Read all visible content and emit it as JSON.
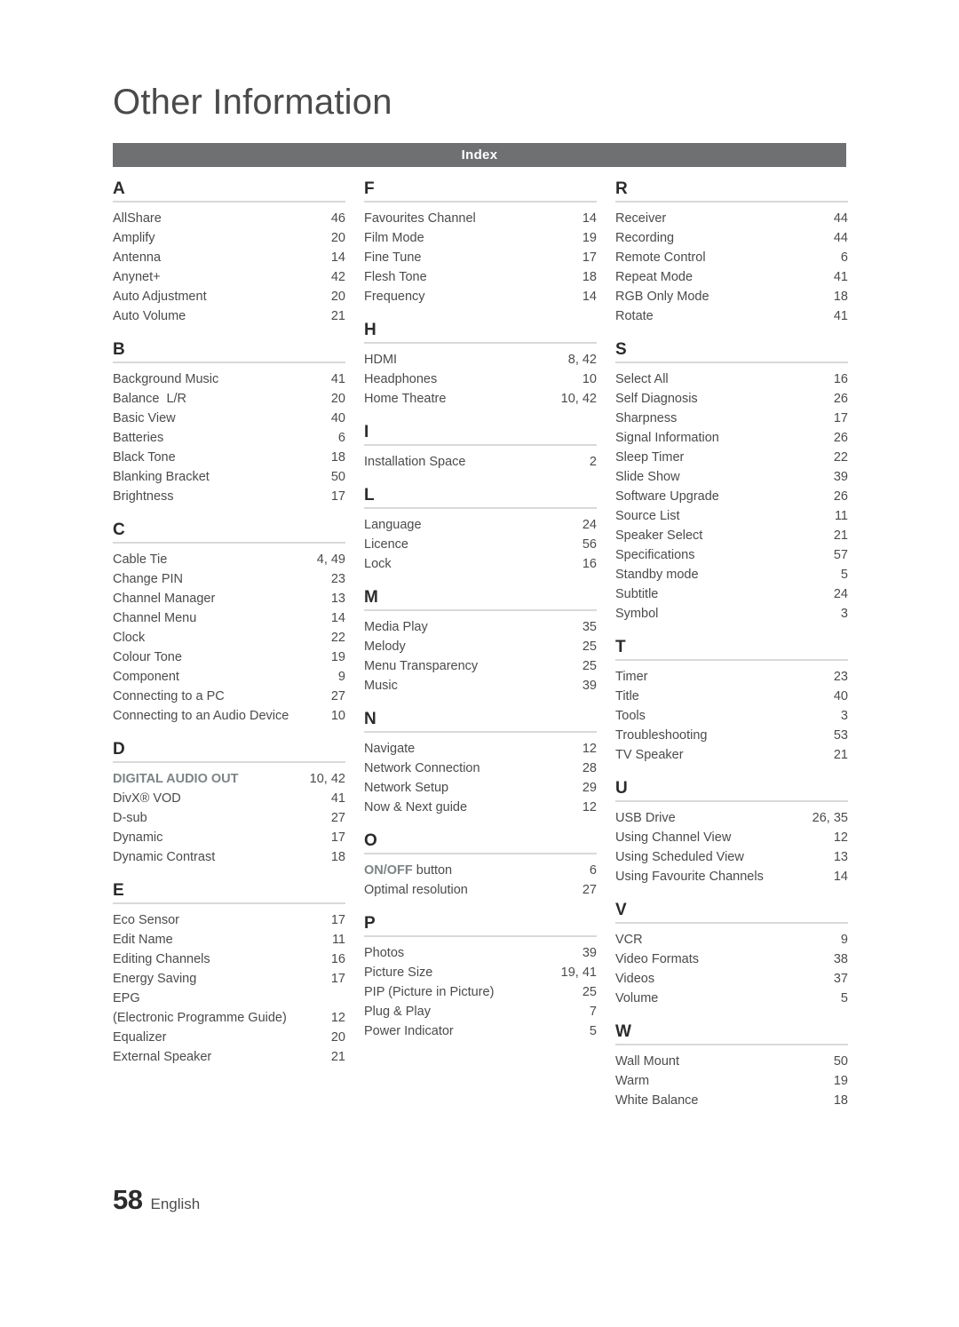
{
  "chapter": {
    "title": "Other Information"
  },
  "index_bar": {
    "label": "Index"
  },
  "footer": {
    "page_number": "58",
    "language": "English"
  },
  "colors": {
    "index_bar_bg": "#6e7072",
    "index_bar_text": "#ffffff",
    "rule": "#d9d9d9",
    "body_text": "#4b4b4b",
    "letter_text": "#2b2b2b",
    "emphasis_text": "#7d8486"
  },
  "columns": [
    {
      "sections": [
        {
          "letter": "A",
          "entries": [
            {
              "label": "AllShare",
              "page": "46"
            },
            {
              "label": "Amplify",
              "page": "20"
            },
            {
              "label": "Antenna",
              "page": "14"
            },
            {
              "label": "Anynet+",
              "page": "42"
            },
            {
              "label": "Auto Adjustment",
              "page": "20"
            },
            {
              "label": "Auto Volume",
              "page": "21"
            }
          ]
        },
        {
          "letter": "B",
          "entries": [
            {
              "label": "Background Music",
              "page": "41"
            },
            {
              "label": "Balance  L/R",
              "page": "20"
            },
            {
              "label": "Basic View",
              "page": "40"
            },
            {
              "label": "Batteries",
              "page": "6"
            },
            {
              "label": "Black Tone",
              "page": "18"
            },
            {
              "label": "Blanking Bracket",
              "page": "50"
            },
            {
              "label": "Brightness",
              "page": "17"
            }
          ]
        },
        {
          "letter": "C",
          "entries": [
            {
              "label": "Cable Tie",
              "page": "4, 49"
            },
            {
              "label": "Change PIN",
              "page": "23"
            },
            {
              "label": "Channel Manager",
              "page": "13"
            },
            {
              "label": "Channel Menu",
              "page": "14"
            },
            {
              "label": "Clock",
              "page": "22"
            },
            {
              "label": "Colour Tone",
              "page": "19"
            },
            {
              "label": "Component",
              "page": "9"
            },
            {
              "label": "Connecting to a PC",
              "page": "27"
            },
            {
              "label": "Connecting to an Audio Device",
              "page": "10"
            }
          ]
        },
        {
          "letter": "D",
          "entries": [
            {
              "label": "DIGITAL AUDIO OUT",
              "page": "10, 42",
              "style": "emph"
            },
            {
              "label": "DivX® VOD",
              "page": "41"
            },
            {
              "label": "D-sub",
              "page": "27"
            },
            {
              "label": "Dynamic",
              "page": "17"
            },
            {
              "label": "Dynamic Contrast",
              "page": "18"
            }
          ]
        },
        {
          "letter": "E",
          "entries": [
            {
              "label": "Eco Sensor",
              "page": "17"
            },
            {
              "label": "Edit Name",
              "page": "11"
            },
            {
              "label": "Editing Channels",
              "page": "16"
            },
            {
              "label": "Energy Saving",
              "page": "17"
            },
            {
              "label": "EPG",
              "label2": "(Electronic Programme Guide)",
              "page": "12",
              "style": "multiline"
            },
            {
              "label": "Equalizer",
              "page": "20"
            },
            {
              "label": "External Speaker",
              "page": "21"
            }
          ]
        }
      ]
    },
    {
      "sections": [
        {
          "letter": "F",
          "entries": [
            {
              "label": "Favourites Channel",
              "page": "14"
            },
            {
              "label": "Film Mode",
              "page": "19"
            },
            {
              "label": "Fine Tune",
              "page": "17"
            },
            {
              "label": "Flesh Tone",
              "page": "18"
            },
            {
              "label": "Frequency",
              "page": "14"
            }
          ]
        },
        {
          "letter": "H",
          "entries": [
            {
              "label": "HDMI",
              "page": "8, 42"
            },
            {
              "label": "Headphones",
              "page": "10"
            },
            {
              "label": "Home Theatre",
              "page": "10, 42"
            }
          ]
        },
        {
          "letter": "I",
          "entries": [
            {
              "label": "Installation Space",
              "page": "2"
            }
          ]
        },
        {
          "letter": "L",
          "entries": [
            {
              "label": "Language",
              "page": "24"
            },
            {
              "label": "Licence",
              "page": "56"
            },
            {
              "label": "Lock",
              "page": "16"
            }
          ]
        },
        {
          "letter": "M",
          "entries": [
            {
              "label": "Media Play",
              "page": "35"
            },
            {
              "label": "Melody",
              "page": "25"
            },
            {
              "label": "Menu Transparency",
              "page": "25"
            },
            {
              "label": "Music",
              "page": "39"
            }
          ]
        },
        {
          "letter": "N",
          "entries": [
            {
              "label": "Navigate",
              "page": "12"
            },
            {
              "label": "Network Connection",
              "page": "28"
            },
            {
              "label": "Network Setup",
              "page": "29"
            },
            {
              "label": "Now & Next guide",
              "page": "12"
            }
          ]
        },
        {
          "letter": "O",
          "entries": [
            {
              "label": "ON/OFF button",
              "emph_prefix": "ON/OFF",
              "emph_suffix": " button",
              "page": "6",
              "style": "emph-partial"
            },
            {
              "label": "Optimal resolution",
              "page": "27"
            }
          ]
        },
        {
          "letter": "P",
          "entries": [
            {
              "label": "Photos",
              "page": "39"
            },
            {
              "label": "Picture Size",
              "page": "19, 41"
            },
            {
              "label": "PIP (Picture in Picture)",
              "page": "25"
            },
            {
              "label": "Plug & Play",
              "page": "7"
            },
            {
              "label": "Power Indicator",
              "page": "5"
            }
          ]
        }
      ]
    },
    {
      "sections": [
        {
          "letter": "R",
          "entries": [
            {
              "label": "Receiver",
              "page": "44"
            },
            {
              "label": "Recording",
              "page": "44"
            },
            {
              "label": "Remote Control",
              "page": "6"
            },
            {
              "label": "Repeat Mode",
              "page": "41"
            },
            {
              "label": "RGB Only Mode",
              "page": "18"
            },
            {
              "label": "Rotate",
              "page": "41"
            }
          ]
        },
        {
          "letter": "S",
          "entries": [
            {
              "label": "Select All",
              "page": "16"
            },
            {
              "label": "Self Diagnosis",
              "page": "26"
            },
            {
              "label": "Sharpness",
              "page": "17"
            },
            {
              "label": "Signal Information",
              "page": "26"
            },
            {
              "label": "Sleep Timer",
              "page": "22"
            },
            {
              "label": "Slide Show",
              "page": "39"
            },
            {
              "label": "Software Upgrade",
              "page": "26"
            },
            {
              "label": "Source List",
              "page": "11"
            },
            {
              "label": "Speaker Select",
              "page": "21"
            },
            {
              "label": "Specifications",
              "page": "57"
            },
            {
              "label": "Standby mode",
              "page": "5"
            },
            {
              "label": "Subtitle",
              "page": "24"
            },
            {
              "label": "Symbol",
              "page": "3"
            }
          ]
        },
        {
          "letter": "T",
          "entries": [
            {
              "label": "Timer",
              "page": "23"
            },
            {
              "label": "Title",
              "page": "40"
            },
            {
              "label": "Tools",
              "page": "3"
            },
            {
              "label": "Troubleshooting",
              "page": "53"
            },
            {
              "label": "TV Speaker",
              "page": "21"
            }
          ]
        },
        {
          "letter": "U",
          "entries": [
            {
              "label": "USB Drive",
              "page": "26, 35"
            },
            {
              "label": "Using Channel View",
              "page": "12"
            },
            {
              "label": "Using Scheduled View",
              "page": "13"
            },
            {
              "label": "Using Favourite Channels",
              "page": "14"
            }
          ]
        },
        {
          "letter": "V",
          "entries": [
            {
              "label": "VCR",
              "page": "9"
            },
            {
              "label": "Video Formats",
              "page": "38"
            },
            {
              "label": "Videos",
              "page": "37"
            },
            {
              "label": "Volume",
              "page": "5"
            }
          ]
        },
        {
          "letter": "W",
          "entries": [
            {
              "label": "Wall Mount",
              "page": "50"
            },
            {
              "label": "Warm",
              "page": "19"
            },
            {
              "label": "White Balance",
              "page": "18"
            }
          ]
        }
      ]
    }
  ]
}
